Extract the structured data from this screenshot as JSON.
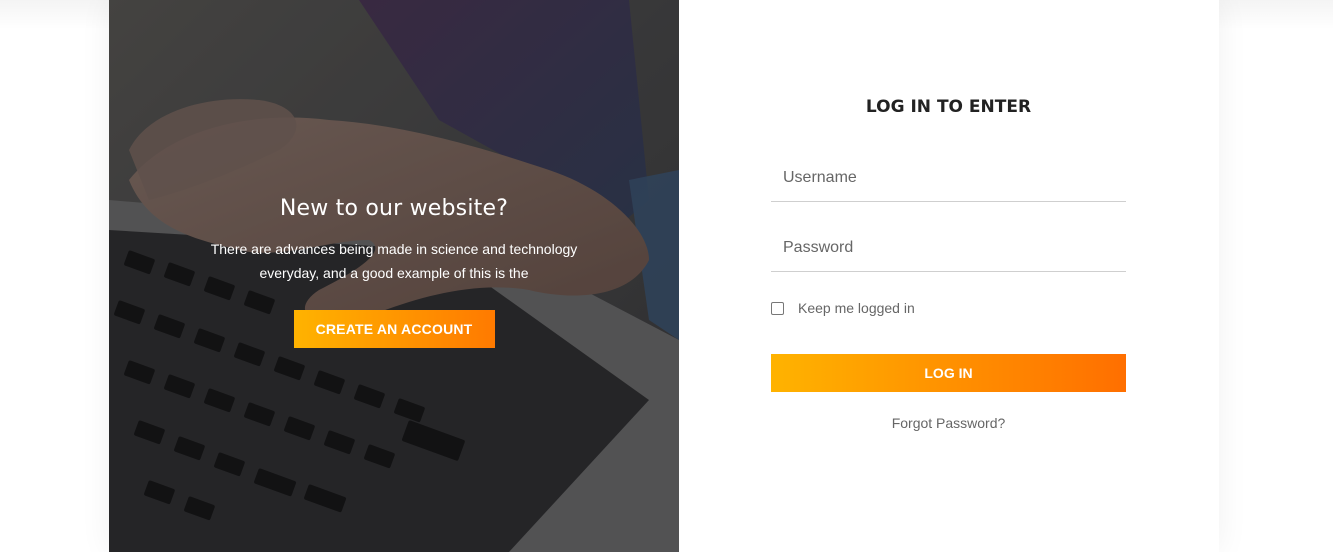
{
  "hero": {
    "title": "New to our website?",
    "text": "There are advances being made in science and technology everyday, and a good example of this is the",
    "button_label": "CREATE AN ACCOUNT"
  },
  "login": {
    "title": "LOG IN TO ENTER",
    "username_placeholder": "Username",
    "password_placeholder": "Password",
    "remember_label": "Keep me logged in",
    "remember_checked": false,
    "submit_label": "LOG IN",
    "forgot_label": "Forgot Password?"
  },
  "colors": {
    "accent_start": "#ffb300",
    "accent_end": "#ff6f00"
  }
}
